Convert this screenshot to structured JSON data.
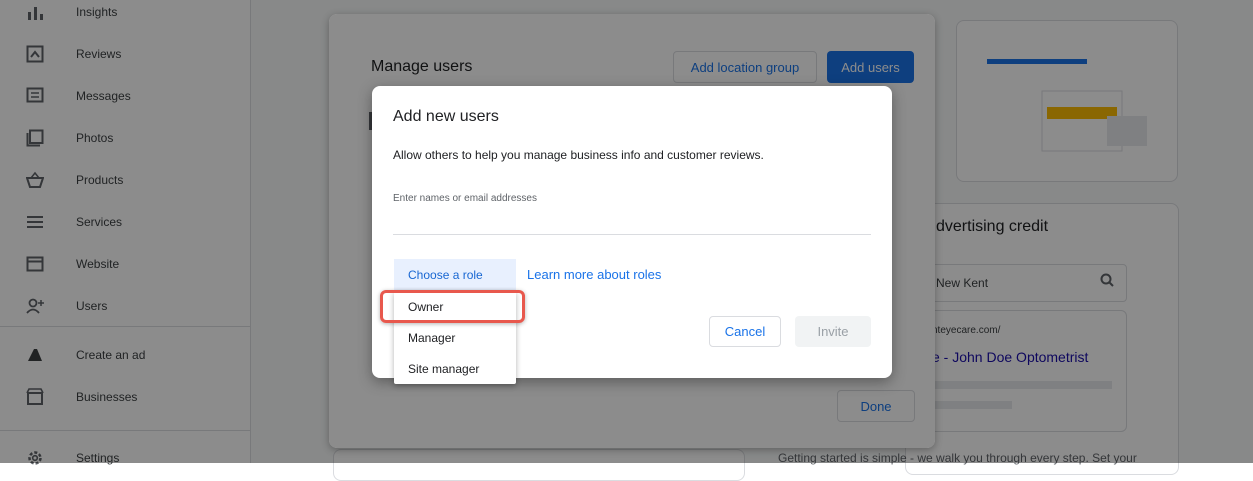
{
  "sidebar": {
    "items": [
      {
        "label": "Insights",
        "icon": "insights-icon"
      },
      {
        "label": "Reviews",
        "icon": "reviews-icon"
      },
      {
        "label": "Messages",
        "icon": "messages-icon"
      },
      {
        "label": "Photos",
        "icon": "photos-icon"
      },
      {
        "label": "Products",
        "icon": "products-icon"
      },
      {
        "label": "Services",
        "icon": "services-icon"
      },
      {
        "label": "Website",
        "icon": "website-icon"
      },
      {
        "label": "Users",
        "icon": "users-icon"
      },
      {
        "label": "Create an ad",
        "icon": "ads-icon"
      },
      {
        "label": "Businesses",
        "icon": "businesses-icon"
      },
      {
        "label": "Settings",
        "icon": "settings-icon"
      }
    ]
  },
  "background": {
    "ad_credit_title": "dvertising credit",
    "location_value": "New Kent",
    "site_url": "nteyecare.com/",
    "site_title": "e - John Doe Optometrist",
    "footer_text": "Getting started is simple - we walk you through every step. Set your"
  },
  "manage_users": {
    "title": "Manage users",
    "add_location_group_label": "Add location group",
    "add_users_label": "Add users",
    "done_label": "Done"
  },
  "add_users": {
    "title": "Add new users",
    "description": "Allow others to help you manage business info and customer reviews.",
    "input_placeholder": "Enter names or email addresses",
    "role_select_label": "Choose a role",
    "learn_more_label": "Learn more about roles",
    "cancel_label": "Cancel",
    "invite_label": "Invite"
  },
  "role_options": [
    "Owner",
    "Manager",
    "Site manager"
  ],
  "colors": {
    "accent": "#1a73e8",
    "highlight": "#e8584d",
    "scrim": "rgba(0,0,0,0.45)"
  }
}
